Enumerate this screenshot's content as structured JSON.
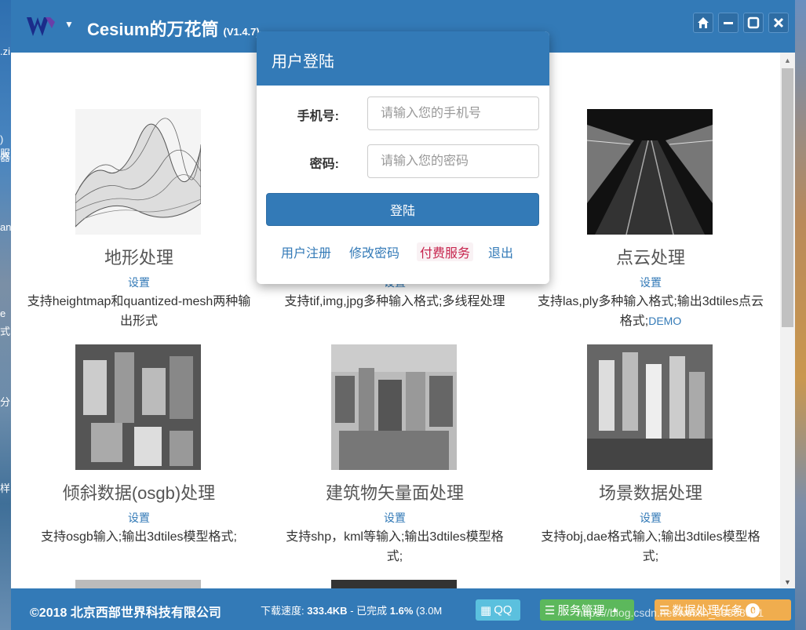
{
  "desktop": {
    "left_fragments": [
      ".zi",
      ")服",
      "器",
      "an",
      "e",
      "式",
      "分",
      "样"
    ]
  },
  "app": {
    "title": "Cesium的万花筒",
    "version": "(V1.4.7)",
    "window_buttons": [
      "home-icon",
      "minimize-icon",
      "restore-icon",
      "close-icon"
    ]
  },
  "cards": [
    {
      "name": "地形处理",
      "setting": "设置",
      "desc": "支持heightmap和quantized-mesh两种输出形式",
      "demo": ""
    },
    {
      "name": "",
      "setting": "设置",
      "desc": "支持tif,img,jpg多种输入格式;多线程处理",
      "demo": ""
    },
    {
      "name": "点云处理",
      "setting": "设置",
      "desc": "支持las,ply多种输入格式;输出3dtiles点云格式;",
      "demo": "DEMO"
    },
    {
      "name": "倾斜数据(osgb)处理",
      "setting": "设置",
      "desc": "支持osgb输入;输出3dtiles模型格式;",
      "demo": ""
    },
    {
      "name": "建筑物矢量面处理",
      "setting": "设置",
      "desc": "支持shp，kml等输入;输出3dtiles模型格式;",
      "demo": ""
    },
    {
      "name": "场景数据处理",
      "setting": "设置",
      "desc": "支持obj,dae格式输入;输出3dtiles模型格式;",
      "demo": ""
    }
  ],
  "modal": {
    "title": "用户登陆",
    "phone_label": "手机号:",
    "phone_placeholder": "请输入您的手机号",
    "password_label": "密码:",
    "password_placeholder": "请输入您的密码",
    "login_button": "登陆",
    "links": {
      "register": "用户注册",
      "change_password": "修改密码",
      "paid_service": "付费服务",
      "logout": "退出"
    }
  },
  "footer": {
    "copyright": "©2018 北京西部世界科技有限公司",
    "download_label": "下载速度:",
    "download_speed": "333.4KB",
    "progress_label": "- 已完成",
    "progress_percent": "1.6%",
    "progress_extra": "(3.0M",
    "qq": "QQ",
    "service": "服务管理",
    "task": "数据处理任务",
    "task_count": "0"
  },
  "watermark": "https://blog.csdn.net/weixin_38898641",
  "colors": {
    "primary": "#337ab7",
    "info": "#5bc0de",
    "success": "#5cb85c",
    "warning": "#f0ad4e"
  }
}
